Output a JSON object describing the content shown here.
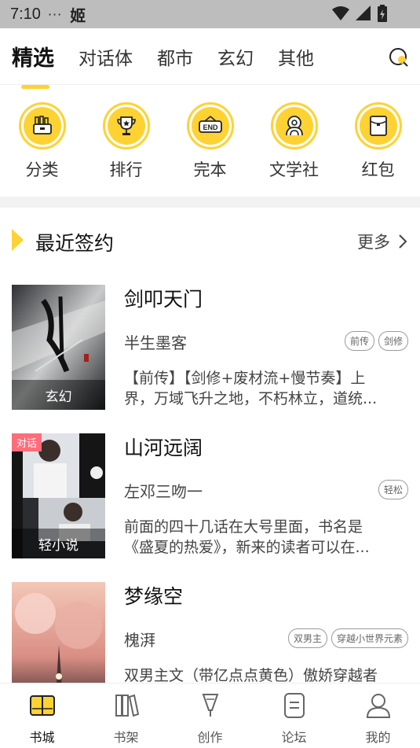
{
  "status_bar": {
    "time": "7:10",
    "dots": "···",
    "app_glyph": "姬"
  },
  "top_tabs": [
    {
      "label": "精选",
      "active": true
    },
    {
      "label": "对话体",
      "active": false
    },
    {
      "label": "都市",
      "active": false
    },
    {
      "label": "玄幻",
      "active": false
    },
    {
      "label": "其他",
      "active": false
    }
  ],
  "quick_entries": [
    {
      "label": "分类",
      "icon": "category-basket-icon"
    },
    {
      "label": "排行",
      "icon": "trophy-icon"
    },
    {
      "label": "完本",
      "icon": "end-sign-icon"
    },
    {
      "label": "文学社",
      "icon": "community-people-icon"
    },
    {
      "label": "红包",
      "icon": "red-packet-icon"
    }
  ],
  "section": {
    "title": "最近签约",
    "more": "更多"
  },
  "books": [
    {
      "title": "剑叩天门",
      "author": "半生墨客",
      "genre": "玄幻",
      "badge": "",
      "tags": [
        "前传",
        "剑修"
      ],
      "desc_line1": "【前传】【剑修+废材流+慢节奏】上",
      "desc_line2": "界，万域飞升之地，不朽林立，道统..."
    },
    {
      "title": "山河远阔",
      "author": "左邓三吻一",
      "genre": "轻小说",
      "badge": "对话",
      "tags": [
        "轻松"
      ],
      "desc_line1": "前面的四十几话在大号里面，书名是",
      "desc_line2": "《盛夏的热爱》，新来的读者可以在..."
    },
    {
      "title": "梦缘空",
      "author": "槐湃",
      "genre": "",
      "badge": "",
      "tags": [
        "双男主",
        "穿越小世界元素"
      ],
      "desc_line1": "双男主文（带亿点点黄色）傲娇穿越者",
      "desc_line2": ""
    }
  ],
  "bottom_nav": [
    {
      "label": "书城",
      "icon": "bookstore-icon",
      "active": true
    },
    {
      "label": "书架",
      "icon": "bookshelf-icon",
      "active": false
    },
    {
      "label": "创作",
      "icon": "write-pen-icon",
      "active": false
    },
    {
      "label": "论坛",
      "icon": "forum-icon",
      "active": false
    },
    {
      "label": "我的",
      "icon": "profile-icon",
      "active": false
    }
  ],
  "colors": {
    "accent": "#ffd233",
    "status_bar": "#bdbdbd",
    "badge": "#ff6d7a"
  }
}
